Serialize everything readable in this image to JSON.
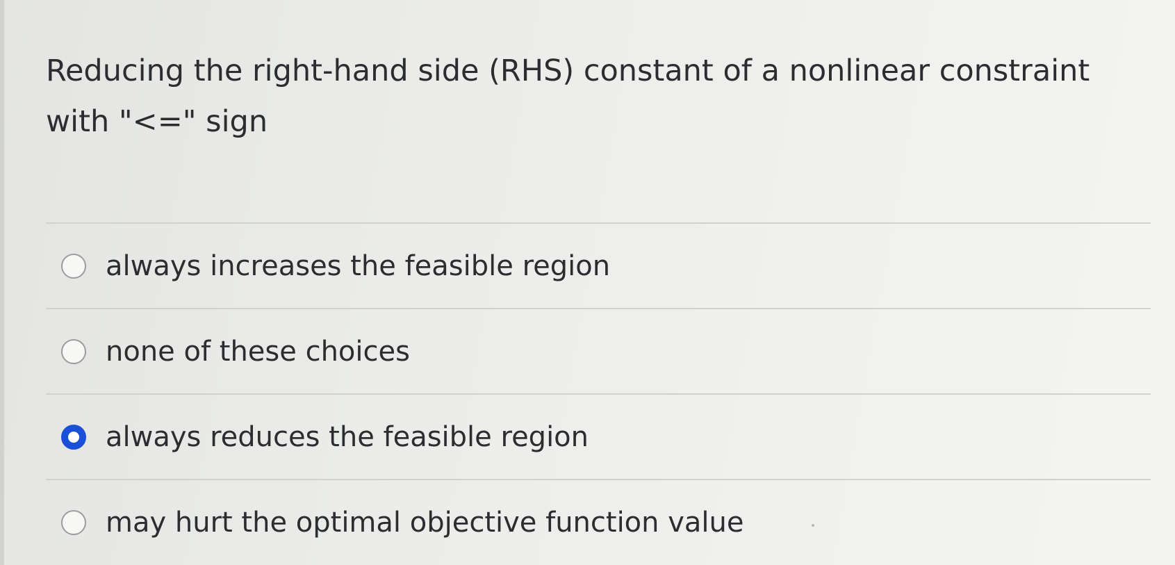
{
  "question": {
    "line1": "Reducing the right-hand side (RHS) constant of a nonlinear constraint",
    "line2": "with \"<=\" sign"
  },
  "options": [
    {
      "label": "always increases the feasible region",
      "selected": false
    },
    {
      "label": "none of these choices",
      "selected": false
    },
    {
      "label": "always reduces the feasible region",
      "selected": true
    },
    {
      "label": "may hurt the optimal objective function value",
      "selected": false
    }
  ],
  "colors": {
    "selected_radio": "#1a4fd8",
    "text": "#2b2d31",
    "divider": "#d1d2cf"
  }
}
